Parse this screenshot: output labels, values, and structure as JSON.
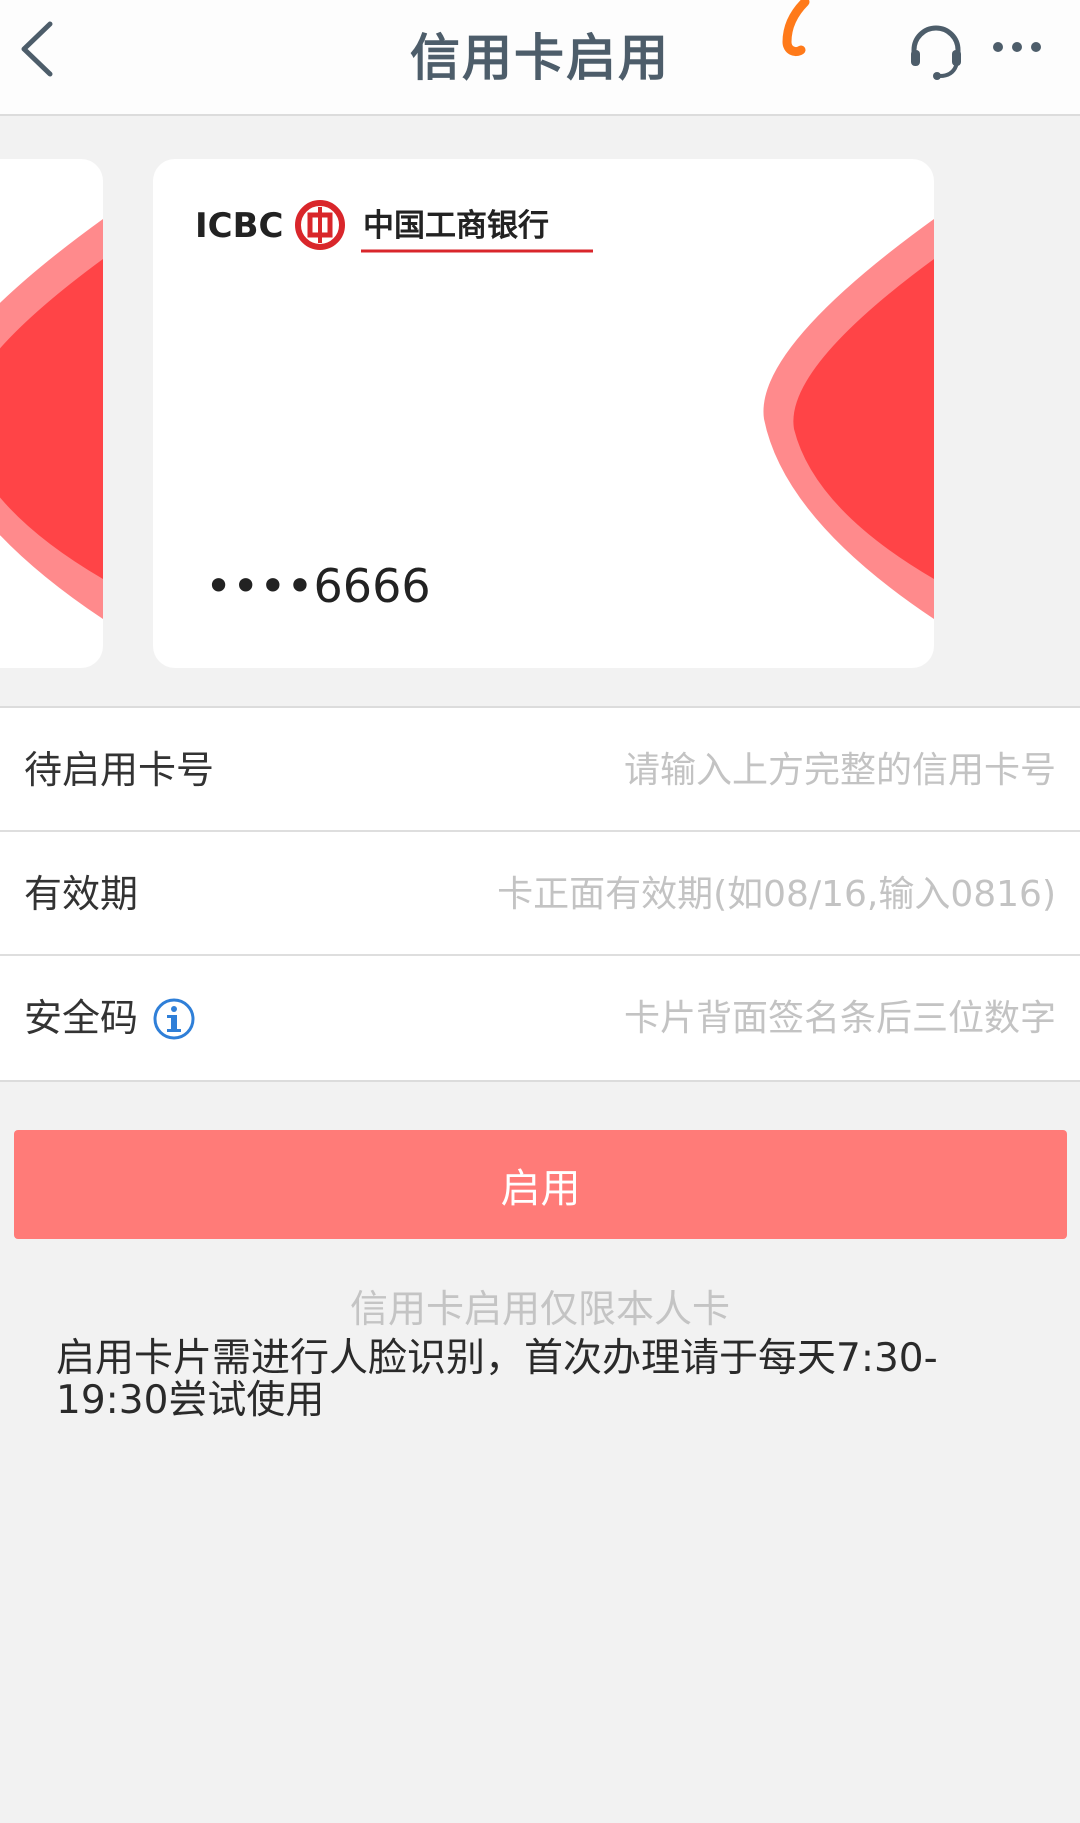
{
  "header": {
    "title": "信用卡启用"
  },
  "card": {
    "bank_logo_text": "ICBC",
    "bank_name": "中国工商银行",
    "masked_number": "••••6666"
  },
  "form": {
    "card_number": {
      "label": "待启用卡号",
      "placeholder": "请输入上方完整的信用卡号"
    },
    "expiry": {
      "label": "有效期",
      "placeholder": "卡正面有效期(如08/16,输入0816)"
    },
    "cvv": {
      "label": "安全码",
      "placeholder": "卡片背面签名条后三位数字"
    }
  },
  "actions": {
    "enable_label": "启用"
  },
  "notes": {
    "limit": "信用卡启用仅限本人卡",
    "face_recognition": "启用卡片需进行人脸识别，首次办理请于每天7:30-19:30尝试使用"
  },
  "colors": {
    "accent": "#ff7b78",
    "card_red": "#ff4447",
    "title_text": "#4d5d6a"
  }
}
